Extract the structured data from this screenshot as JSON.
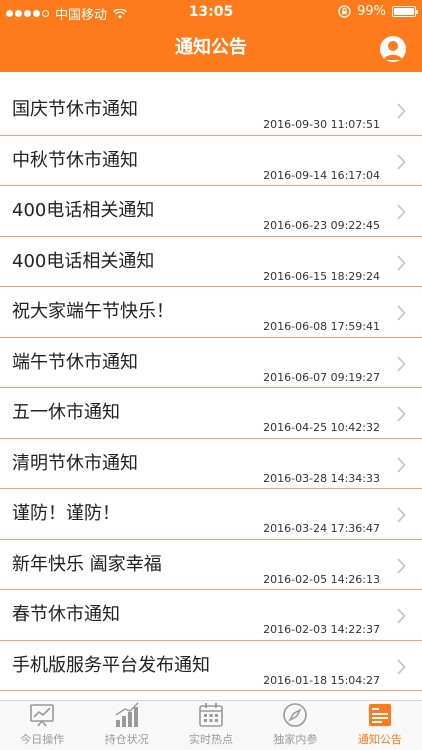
{
  "status_bar": {
    "carrier": "中国移动",
    "time": "13:05",
    "battery_percent": "99%",
    "battery_level": 0.99,
    "signal_bars_filled": 4,
    "signal_bars_total": 5
  },
  "header": {
    "title": "通知公告",
    "profile_icon": "user-icon",
    "background_color": "#ff7a1a"
  },
  "notices": [
    {
      "title": "国庆节休市通知",
      "date": "2016-09-30 11:07:51"
    },
    {
      "title": "中秋节休市通知",
      "date": "2016-09-14 16:17:04"
    },
    {
      "title": "400电话相关通知",
      "date": "2016-06-23 09:22:45"
    },
    {
      "title": "400电话相关通知",
      "date": "2016-06-15 18:29:24"
    },
    {
      "title": "祝大家端午节快乐！",
      "date": "2016-06-08 17:59:41"
    },
    {
      "title": "端午节休市通知",
      "date": "2016-06-07 09:19:27"
    },
    {
      "title": "五一休市通知",
      "date": "2016-04-25 10:42:32"
    },
    {
      "title": "清明节休市通知",
      "date": "2016-03-28 14:34:33"
    },
    {
      "title": "谨防！谨防！",
      "date": "2016-03-24 17:36:47"
    },
    {
      "title": "新年快乐 阖家幸福",
      "date": "2016-02-05 14:26:13"
    },
    {
      "title": "春节休市通知",
      "date": "2016-02-03 14:22:37"
    },
    {
      "title": "手机版服务平台发布通知",
      "date": "2016-01-18 15:04:27"
    }
  ],
  "tabbar": {
    "tabs": [
      {
        "label": "今日操作",
        "icon": "chart-monitor-icon",
        "active": false
      },
      {
        "label": "持仓状况",
        "icon": "bar-chart-icon",
        "active": false
      },
      {
        "label": "实时热点",
        "icon": "calendar-icon",
        "active": false
      },
      {
        "label": "独家内参",
        "icon": "compass-icon",
        "active": false
      },
      {
        "label": "通知公告",
        "icon": "notice-board-icon",
        "active": true
      }
    ],
    "active_color": "#ff7a1a",
    "inactive_color": "#999999"
  }
}
